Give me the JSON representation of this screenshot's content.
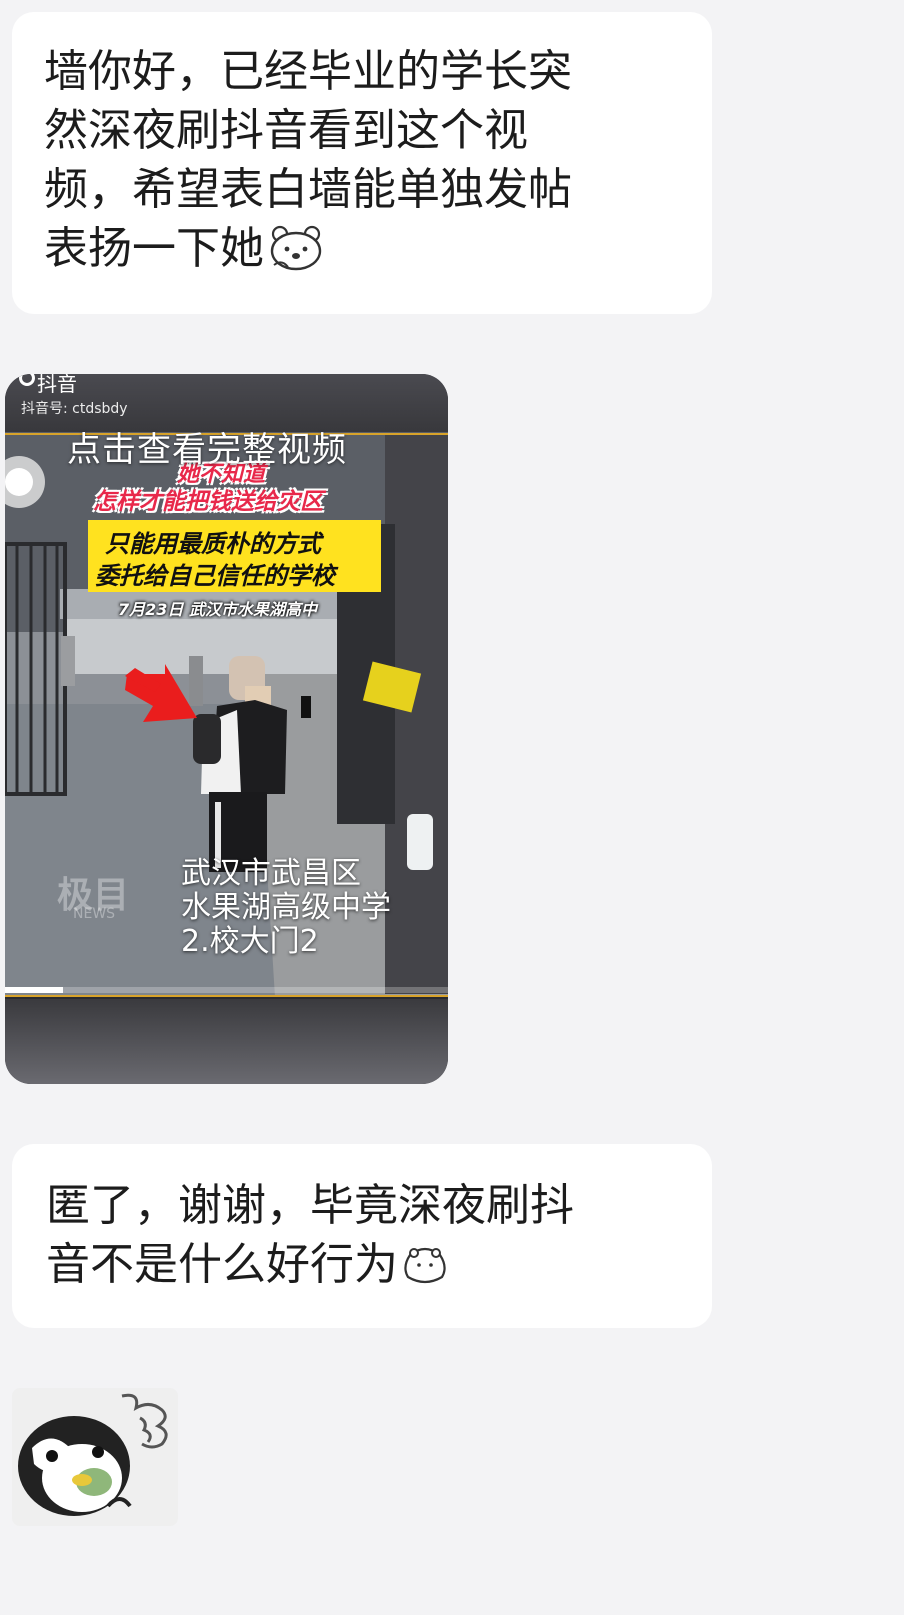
{
  "messages": [
    {
      "lines": [
        "墙你好，已经毕业的学长突",
        "然深夜刷抖音看到这个视",
        "频，希望表白墙能单独发帖",
        "表扬一下她"
      ],
      "trailing_emoji": "bear-emoji"
    },
    {
      "type": "video-card",
      "app_name": "抖音",
      "account": "抖音号: ctdsbdy",
      "action_text": "点击查看完整视频",
      "caption_red_1": "她不知道",
      "caption_red_2": "怎样才能把钱送给灾区",
      "caption_yellow_1": "只能用最质朴的方式",
      "caption_yellow_2": "委托给自己信任的学校",
      "caption_date": "7月23日 武汉市水果湖高中",
      "location_1": "武汉市武昌区",
      "location_2": "水果湖高级中学",
      "location_3": "2.校大门2",
      "watermark": "极目",
      "watermark_sub": "NEWS",
      "progress": 0.13
    },
    {
      "lines": [
        "匿了，谢谢，毕竟深夜刷抖",
        "音不是什么好行为"
      ],
      "trailing_emoji": "bun-face-emoji"
    },
    {
      "type": "sticker",
      "icon": "penguin-eating-sticker"
    }
  ],
  "colors": {
    "background": "#f3f3f5",
    "bubble": "#ffffff",
    "caption_red": "#e8284a",
    "caption_yellow": "#ffe21f"
  }
}
